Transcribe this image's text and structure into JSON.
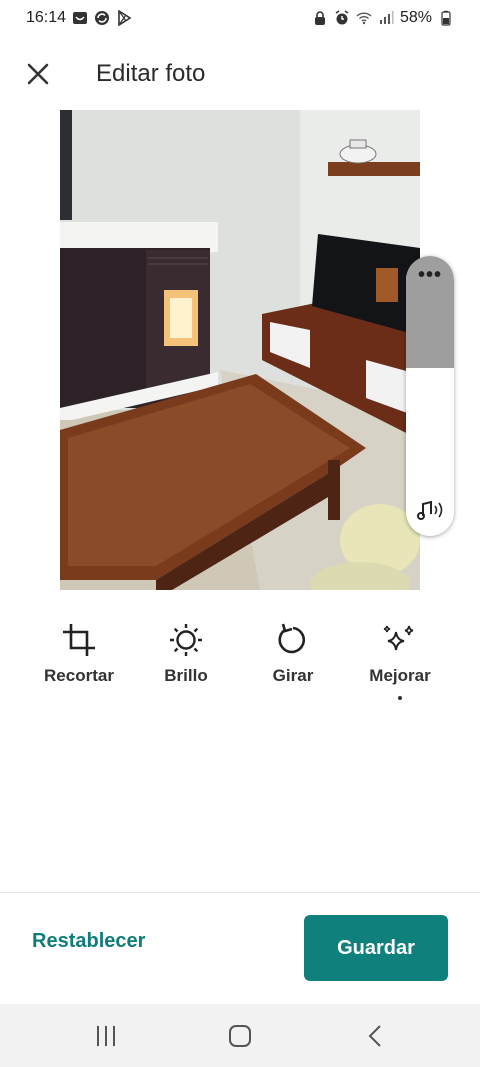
{
  "status_bar": {
    "time": "16:14",
    "battery": "58%",
    "left_icons": [
      "gallery-icon",
      "sync-icon",
      "play-store-icon"
    ],
    "right_icons": [
      "lock-icon",
      "alarm-icon",
      "wifi-icon",
      "signal-icon",
      "battery-icon"
    ]
  },
  "app_bar": {
    "close_icon": "close-icon",
    "title": "Editar foto"
  },
  "photo": {
    "description_icon": "photo"
  },
  "volume_panel": {
    "level": 0.4,
    "menu_icon": "more-dots-icon",
    "sound_icon": "music-note-icon"
  },
  "tools": [
    {
      "label": "Recortar",
      "icon": "crop-icon"
    },
    {
      "label": "Brillo",
      "icon": "brightness-icon"
    },
    {
      "label": "Girar",
      "icon": "rotate-icon"
    },
    {
      "label": "Mejorar",
      "icon": "sparkles-icon",
      "selected": true
    }
  ],
  "footer": {
    "reset_label": "Restablecer",
    "save_label": "Guardar",
    "accent_color": "#0f807c"
  },
  "nav_bar": {
    "recent_icon": "recent-apps-icon",
    "home_icon": "home-icon",
    "back_icon": "back-icon"
  }
}
